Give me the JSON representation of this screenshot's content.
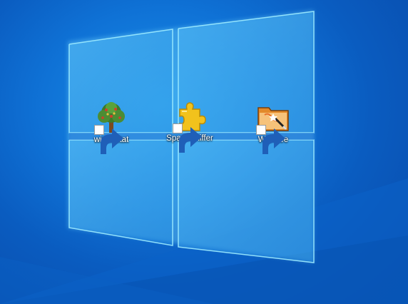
{
  "desktop": {
    "icons": [
      {
        "label": "windirstat",
        "icon": "tree-icon",
        "shortcut": true
      },
      {
        "label": "SpaceSniffer",
        "icon": "puzzle-piece-icon",
        "shortcut": true
      },
      {
        "label": "WizTree",
        "icon": "wizard-folder-icon",
        "shortcut": true
      }
    ]
  },
  "colors": {
    "background": "#0f72d6",
    "window_glow": "#5fd0ff",
    "label_text": "#ffffff"
  }
}
